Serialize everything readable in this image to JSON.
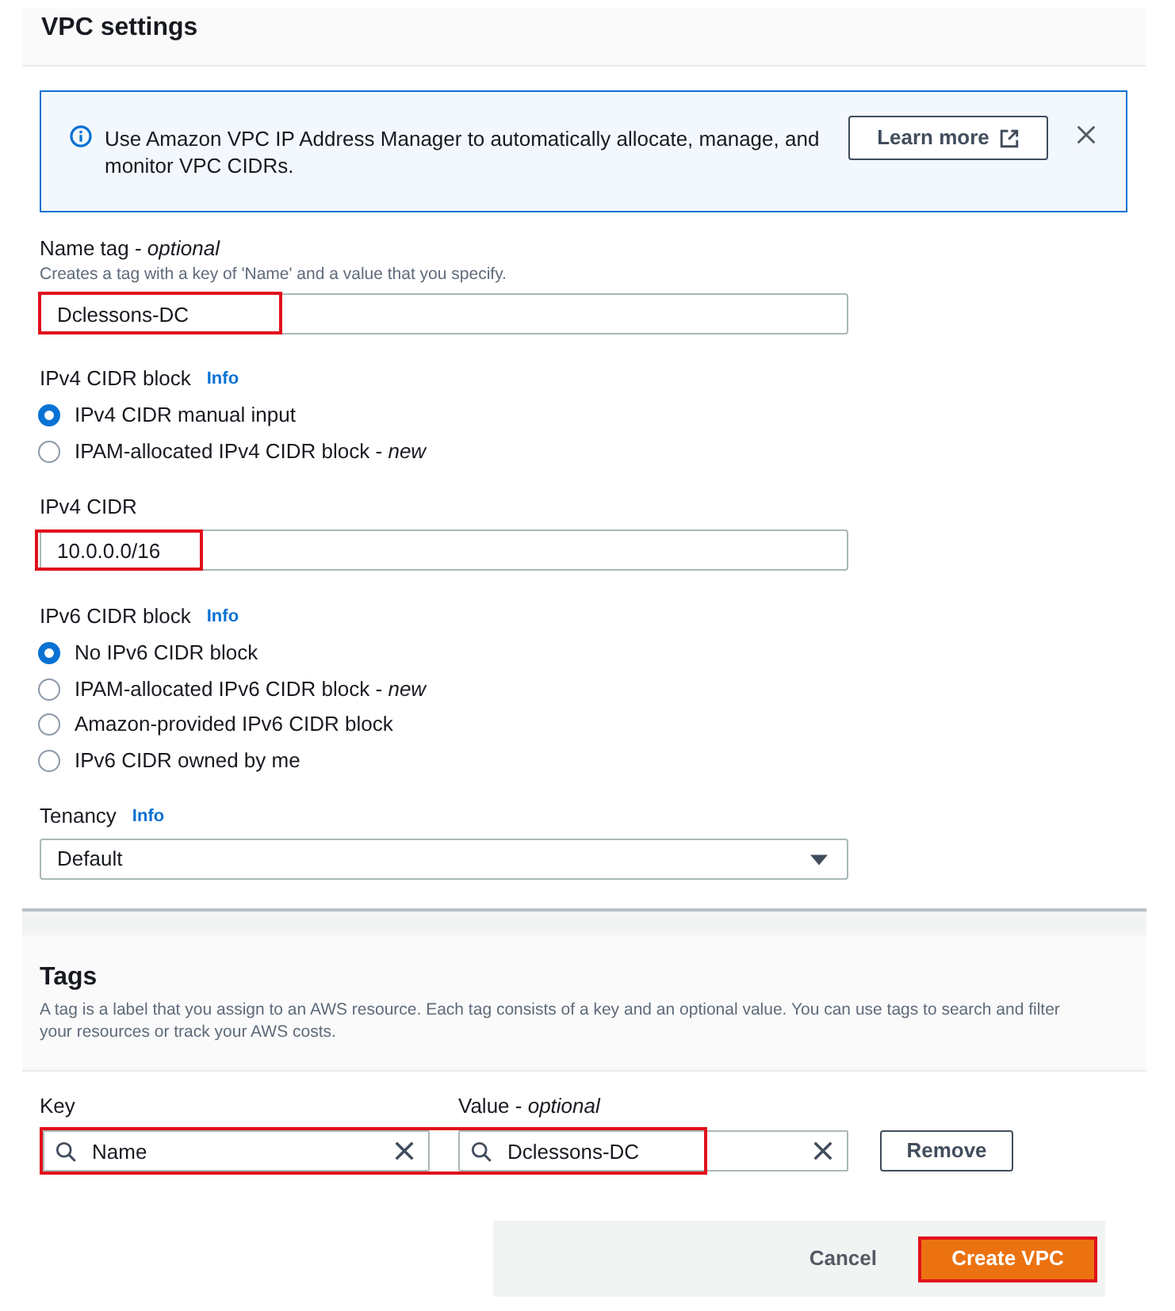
{
  "vpc_settings": {
    "title": "VPC settings",
    "alert": {
      "text": "Use Amazon VPC IP Address Manager to automatically allocate, manage, and monitor VPC CIDRs.",
      "button": "Learn more"
    },
    "name_tag": {
      "label": "Name tag - *optional*",
      "description": "Creates a tag with a key of 'Name' and a value that you specify.",
      "value": "Dclessons-DC",
      "highlighted": true
    },
    "ipv4_cidr_block": {
      "label": "IPv4 CIDR block",
      "info": "Info",
      "options": [
        {
          "label": "IPv4 CIDR manual input",
          "selected": true
        },
        {
          "label": "IPAM-allocated IPv4 CIDR block - *new*",
          "selected": false
        }
      ]
    },
    "ipv4_cidr": {
      "label": "IPv4 CIDR",
      "value": "10.0.0.0/16",
      "highlighted": true
    },
    "ipv6_cidr_block": {
      "label": "IPv6 CIDR block",
      "info": "Info",
      "options": [
        {
          "label": "No IPv6 CIDR block",
          "selected": true
        },
        {
          "label": "IPAM-allocated IPv6 CIDR block - *new*",
          "selected": false
        },
        {
          "label": "Amazon-provided IPv6 CIDR block",
          "selected": false
        },
        {
          "label": "IPv6 CIDR owned by me",
          "selected": false
        }
      ]
    },
    "tenancy": {
      "label": "Tenancy",
      "info": "Info",
      "value": "Default"
    }
  },
  "tags": {
    "title": "Tags",
    "description": "A tag is a label that you assign to an AWS resource. Each tag consists of a key and an optional value. You can use tags to search and filter your resources or track your AWS costs.",
    "key_label": "Key",
    "value_label": "Value - *optional*",
    "rows": [
      {
        "key": "Name",
        "value": "Dclessons-DC",
        "remove_button": "Remove",
        "highlighted": true
      }
    ]
  },
  "footer": {
    "cancel": "Cancel",
    "create": {
      "label": "Create VPC",
      "highlighted": true
    }
  }
}
